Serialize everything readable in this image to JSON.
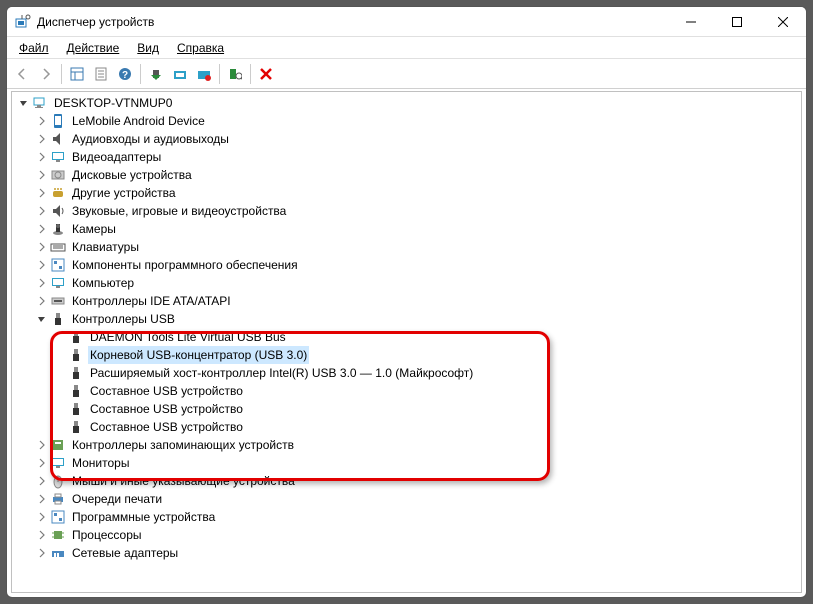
{
  "window": {
    "title": "Диспетчер устройств"
  },
  "menubar": [
    {
      "label": "Файл",
      "ul": 0
    },
    {
      "label": "Действие",
      "ul": 0
    },
    {
      "label": "Вид",
      "ul": 0
    },
    {
      "label": "Справка",
      "ul": 0
    }
  ],
  "root": {
    "label": "DESKTOP-VTNMUP0"
  },
  "categories": [
    {
      "label": "LeMobile Android Device",
      "icon": "phone",
      "color": "#2a7ab8"
    },
    {
      "label": "Аудиовходы и аудиовыходы",
      "icon": "audio",
      "color": "#555"
    },
    {
      "label": "Видеоадаптеры",
      "icon": "display",
      "color": "#2da0c8"
    },
    {
      "label": "Дисковые устройства",
      "icon": "disk",
      "color": "#888"
    },
    {
      "label": "Другие устройства",
      "icon": "other",
      "color": "#c8a030"
    },
    {
      "label": "Звуковые, игровые и видеоустройства",
      "icon": "sound",
      "color": "#555"
    },
    {
      "label": "Камеры",
      "icon": "camera",
      "color": "#333"
    },
    {
      "label": "Клавиатуры",
      "icon": "keyboard",
      "color": "#555"
    },
    {
      "label": "Компоненты программного обеспечения",
      "icon": "software",
      "color": "#4a88c0"
    },
    {
      "label": "Компьютер",
      "icon": "computer",
      "color": "#2da0c8"
    },
    {
      "label": "Контроллеры IDE ATA/ATAPI",
      "icon": "ide",
      "color": "#888"
    }
  ],
  "usb": {
    "label": "Контроллеры USB",
    "items": [
      {
        "label": "DAEMON Tools Lite Virtual USB Bus"
      },
      {
        "label": "Корневой USB-концентратор (USB 3.0)",
        "selected": true
      },
      {
        "label": "Расширяемый хост-контроллер Intel(R) USB 3.0 — 1.0 (Майкрософт)"
      },
      {
        "label": "Составное USB устройство"
      },
      {
        "label": "Составное USB устройство"
      },
      {
        "label": "Составное USB устройство"
      }
    ]
  },
  "categories2": [
    {
      "label": "Контроллеры запоминающих устройств",
      "icon": "storage",
      "color": "#6aa055"
    },
    {
      "label": "Мониторы",
      "icon": "monitor",
      "color": "#2da0c8"
    },
    {
      "label": "Мыши и иные указывающие устройства",
      "icon": "mouse",
      "color": "#555"
    },
    {
      "label": "Очереди печати",
      "icon": "print",
      "color": "#4a88c0"
    },
    {
      "label": "Программные устройства",
      "icon": "softdev",
      "color": "#4a88c0"
    },
    {
      "label": "Процессоры",
      "icon": "cpu",
      "color": "#6aa055"
    },
    {
      "label": "Сетевые адаптеры",
      "icon": "net",
      "color": "#4a88c0"
    }
  ]
}
